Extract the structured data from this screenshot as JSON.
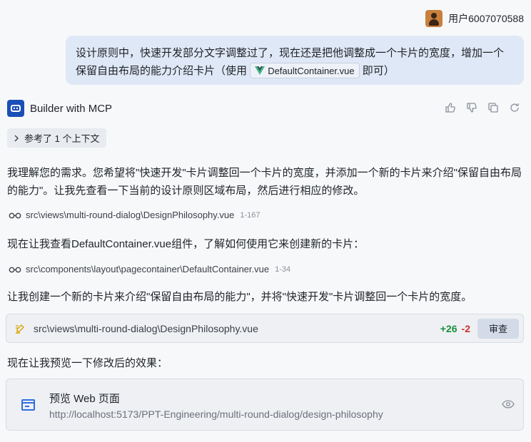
{
  "user": {
    "name": "用户6007070588"
  },
  "user_message": {
    "text_before": "设计原则中，快速开发部分文字调整过了，现在还是把他调整成一个卡片的宽度，增加一个保留自由布局的能力介绍卡片（使用",
    "file_chip": "DefaultContainer.vue",
    "text_after": "即可）"
  },
  "assistant": {
    "name": "Builder with MCP"
  },
  "context": {
    "label": "参考了 1 个上下文"
  },
  "messages": {
    "p1": "我理解您的需求。您希望将\"快速开发\"卡片调整回一个卡片的宽度，并添加一个新的卡片来介绍\"保留自由布局的能力\"。让我先查看一下当前的设计原则区域布局，然后进行相应的修改。",
    "p2": "现在让我查看DefaultContainer.vue组件，了解如何使用它来创建新的卡片：",
    "p3": "让我创建一个新的卡片来介绍\"保留自由布局的能力\"，并将\"快速开发\"卡片调整回一个卡片的宽度。",
    "p4": "现在让我预览一下修改后的效果："
  },
  "file_refs": [
    {
      "path": "src\\views\\multi-round-dialog\\DesignPhilosophy.vue",
      "range": "1-167"
    },
    {
      "path": "src\\components\\layout\\pagecontainer\\DefaultContainer.vue",
      "range": "1-34"
    }
  ],
  "edit": {
    "path": "src\\views\\multi-round-dialog\\DesignPhilosophy.vue",
    "additions": "+26",
    "deletions": "-2",
    "review_label": "审查"
  },
  "preview": {
    "title": "预览 Web 页面",
    "url": "http://localhost:5173/PPT-Engineering/multi-round-dialog/design-philosophy"
  },
  "colors": {
    "accent": "#2f6fe0",
    "additions": "#1a8f3a",
    "deletions": "#d0302f",
    "bubble": "#dfe8f6"
  }
}
